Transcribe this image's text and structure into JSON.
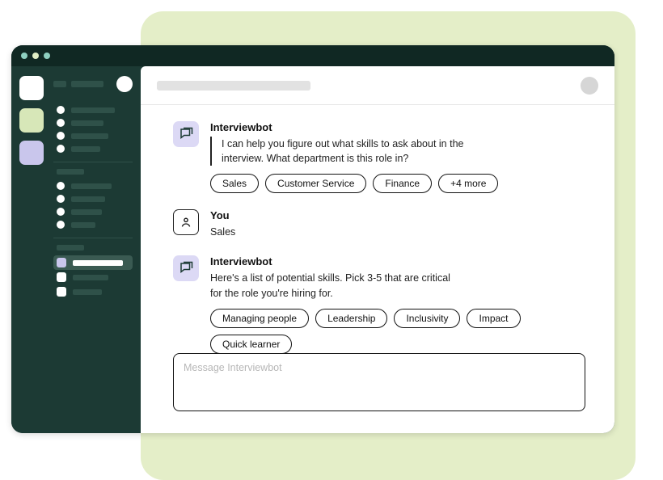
{
  "thread": {
    "messages": [
      {
        "sender": "Interviewbot",
        "text": "I can help you figure out what skills to ask about in the interview. What department is this role in?",
        "show_rule": true,
        "chips": [
          "Sales",
          "Customer Service",
          "Finance",
          "+4 more"
        ]
      },
      {
        "sender": "You",
        "text": "Sales",
        "show_rule": false,
        "chips": []
      },
      {
        "sender": "Interviewbot",
        "text": "Here's a list of potential skills. Pick 3-5 that are critical for the role you're hiring for.",
        "show_rule": false,
        "chips": [
          "Managing people",
          "Leadership",
          "Inclusivity",
          "Impact",
          "Quick learner"
        ]
      }
    ]
  },
  "composer": {
    "placeholder": "Message Interviewbot"
  }
}
